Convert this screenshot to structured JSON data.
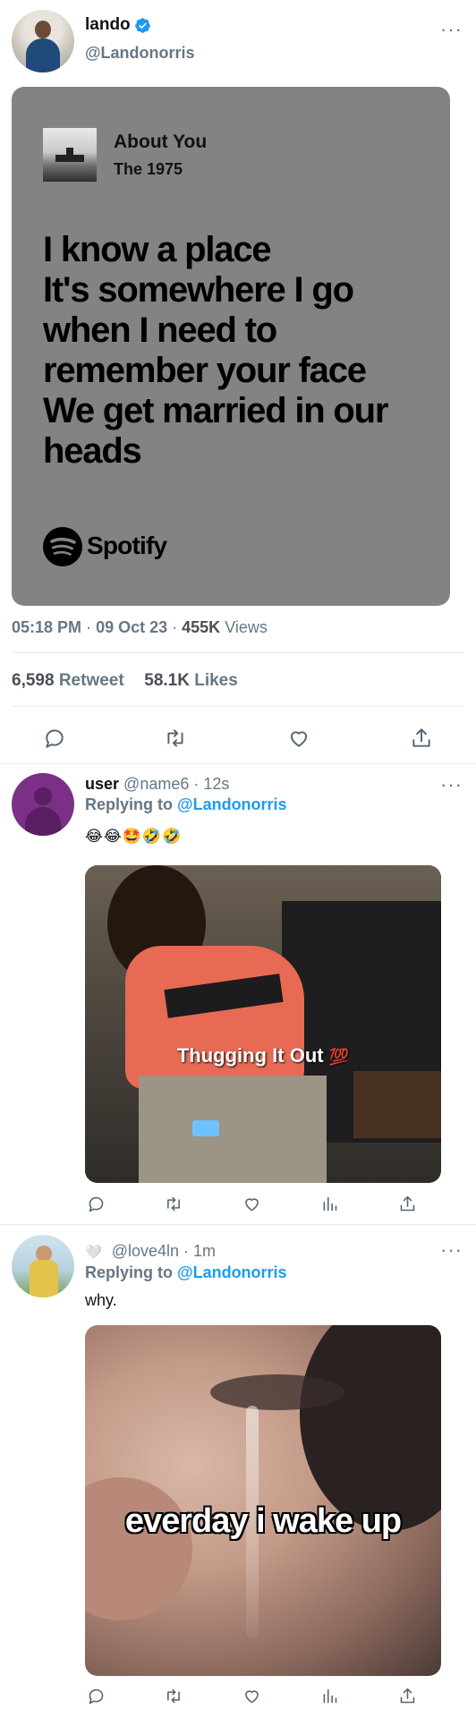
{
  "main_tweet": {
    "display_name": "lando",
    "verified_icon": "verified-badge-icon",
    "handle": "@Landonorris",
    "more_label": "···",
    "spotify_card": {
      "song_title": "About You",
      "artist": "The 1975",
      "lyrics": [
        "I know a place",
        "It's somewhere I go",
        "when I need to",
        "remember your face",
        "We get married in our",
        "heads"
      ],
      "brand": "Spotify",
      "bg_color": "#838383"
    },
    "time": "05:18 PM",
    "date": "09 Oct 23",
    "views_count": "455K",
    "views_label": "Views",
    "retweets_count": "6,598",
    "retweets_label": "Retweet",
    "likes_count": "58.1K",
    "likes_label": "Likes"
  },
  "reply1": {
    "display_name": "user",
    "handle": "@name6",
    "time": "12s",
    "replying_prefix": "Replying to",
    "replying_handle": "@Landonorris",
    "emojis": "😂😂🤩🤣🤣",
    "image_caption": "Thugging It Out",
    "image_caption_emoji": "💯",
    "more_label": "···"
  },
  "reply2": {
    "heart_emoji": "🤍",
    "handle": "@love4ln",
    "time": "1m",
    "replying_prefix": "Replying to",
    "replying_handle": "@Landonorris",
    "text": "why.",
    "image_caption": "everday i wake up",
    "more_label": "···"
  },
  "colors": {
    "accent": "#1d9bf0",
    "secondary_text": "#657786",
    "divider": "#e6ecf0"
  }
}
